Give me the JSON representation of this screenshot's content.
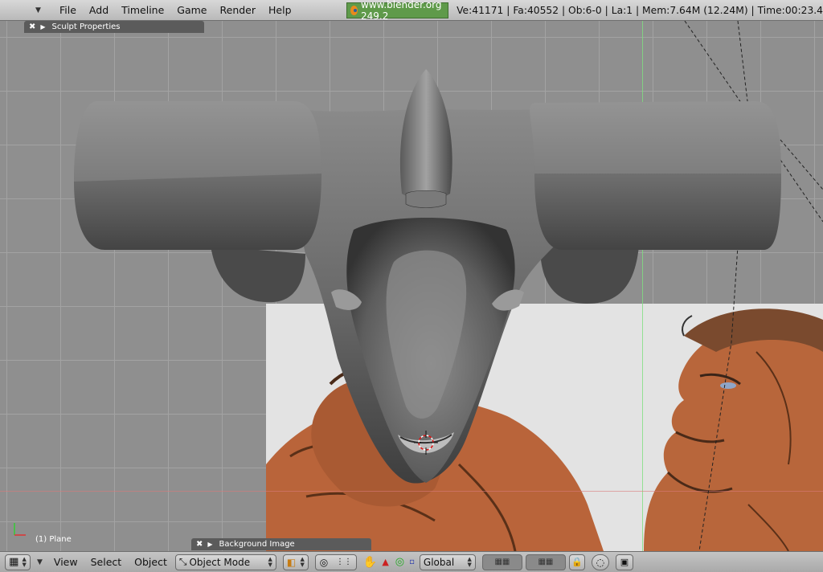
{
  "header": {
    "menus": [
      "File",
      "Add",
      "Timeline",
      "Game",
      "Render",
      "Help"
    ],
    "site_version": "www.blender.org 249.2",
    "stats": "Ve:41171 | Fa:40552 | Ob:6-0 | La:1  | Mem:7.64M (12.24M) | Time:00:23.4"
  },
  "viewport": {
    "sculpt_panel_title": "Sculpt Properties",
    "background_panel_title": "Background Image",
    "active_object_label": "(1) Plane"
  },
  "toolbar": {
    "view_label": "View",
    "select_label": "Select",
    "object_label": "Object",
    "mode": "Object Mode",
    "orientation": "Global"
  },
  "colors": {
    "header_bg": "#c8c8c8",
    "grid_bg": "#8f8f8f",
    "site_badge": "#5f9a4a",
    "x_axis": "#d97a7a",
    "y_axis": "#7ee07e"
  }
}
